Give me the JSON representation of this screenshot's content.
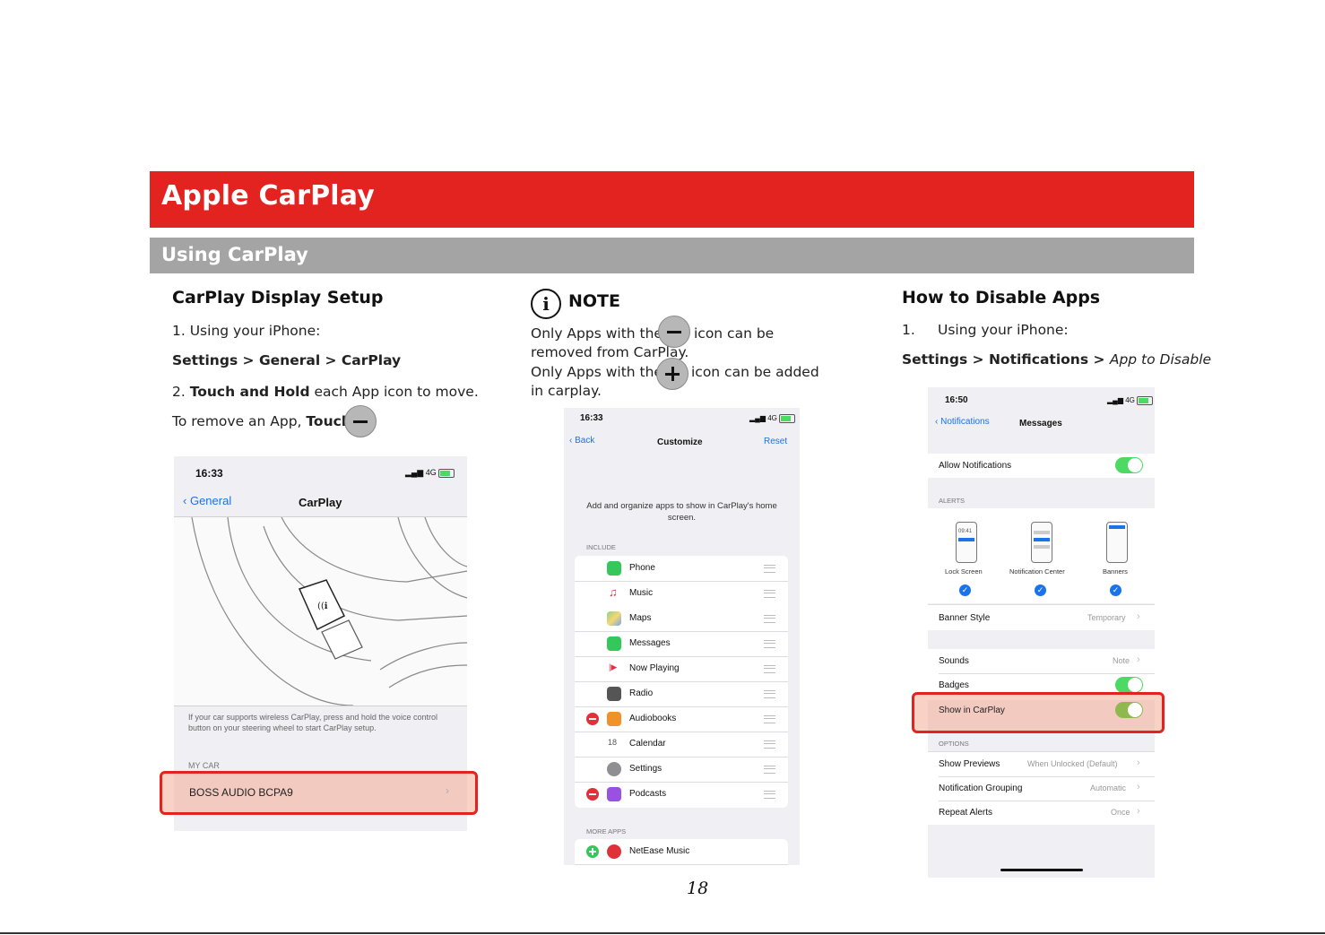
{
  "header": {
    "title": "Apple CarPlay",
    "subtitle": "Using CarPlay"
  },
  "left": {
    "heading": "CarPlay Display Setup",
    "step1": "1.  Using your iPhone:",
    "path": "Settings > General > CarPlay",
    "step2_prefix": "2. ",
    "step2_bold": "Touch and Hold",
    "step2_rest": " each App icon to move.",
    "remove_prefix": "To remove an App, ",
    "remove_bold": "Touch",
    "phone": {
      "time": "16:33",
      "network": "4G",
      "back": "General",
      "title": "CarPlay",
      "description": "If your car supports wireless CarPlay, press and hold the voice control button on your steering wheel to start CarPlay setup.",
      "section": "MY CAR",
      "car": "BOSS AUDIO BCPA9"
    }
  },
  "middle": {
    "note_title": "NOTE",
    "note1_a": "Only Apps with the",
    "note1_b": "icon can be",
    "note1_c": "removed from CarPlay.",
    "note2_a": "Only Apps with the",
    "note2_b": "icon can be added",
    "note2_c": "in carplay.",
    "phone": {
      "time": "16:33",
      "network": "4G",
      "back": "Back",
      "title": "Customize",
      "reset": "Reset",
      "intro": "Add and organize apps to show in CarPlay's home screen.",
      "include": "INCLUDE",
      "apps": [
        "Phone",
        "Music",
        "Maps",
        "Messages",
        "Now Playing",
        "Radio",
        "Audiobooks",
        "Calendar",
        "Settings",
        "Podcasts"
      ],
      "more": "MORE APPS",
      "more_apps": [
        "NetEase Music"
      ]
    }
  },
  "right": {
    "heading": "How to Disable Apps",
    "step1_num": "1.",
    "step1": "Using your iPhone:",
    "path_bold": "Settings > Notifications > ",
    "path_italic": "App to Disable",
    "phone": {
      "time": "16:50",
      "network": "4G",
      "back": "Notifications",
      "title": "Messages",
      "allow": "Allow Notifications",
      "alerts": "ALERTS",
      "alert_types": [
        "Lock Screen",
        "Notification Center",
        "Banners"
      ],
      "lock_time": "09:41",
      "banner_style": "Banner Style",
      "banner_style_value": "Temporary",
      "sounds": "Sounds",
      "sounds_value": "Note",
      "badges": "Badges",
      "show_carplay": "Show in CarPlay",
      "options": "OPTIONS",
      "previews": "Show Previews",
      "previews_value": "When Unlocked (Default)",
      "grouping": "Notification Grouping",
      "grouping_value": "Automatic",
      "repeat": "Repeat Alerts",
      "repeat_value": "Once"
    }
  },
  "footer": {
    "page": "18"
  },
  "colors": {
    "brand_red": "#e2231f",
    "subbar_gray": "#a4a4a4",
    "highlight": "#f4ac96",
    "ios_blue": "#1a73e8",
    "ios_green": "#4cd964"
  }
}
